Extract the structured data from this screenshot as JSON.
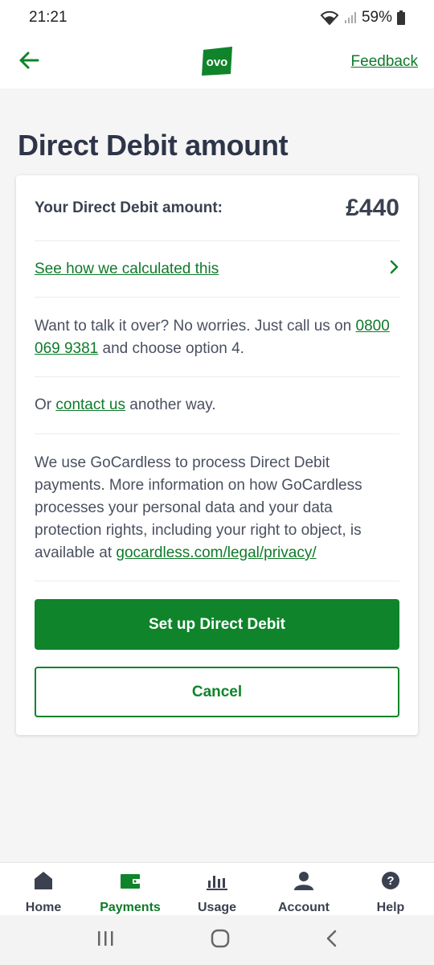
{
  "status_bar": {
    "time": "21:21",
    "battery": "59%"
  },
  "header": {
    "feedback_label": "Feedback",
    "logo_text": "ovo"
  },
  "page": {
    "title": "Direct Debit amount"
  },
  "card": {
    "amount_label": "Your Direct Debit amount:",
    "amount_value": "£440",
    "calc_link": "See how we calculated this",
    "talk_prefix": "Want to talk it over? No worries. Just call us on ",
    "phone": "0800 069 9381",
    "talk_suffix": " and choose option 4.",
    "contact_prefix": "Or ",
    "contact_link": "contact us",
    "contact_suffix": " another way.",
    "gc_text": "We use GoCardless to process Direct Debit payments. More information on how GoCardless processes your personal data and your data protection rights, including your right to object, is available at ",
    "gc_link": "gocardless.com/legal/privacy/"
  },
  "buttons": {
    "primary": "Set up Direct Debit",
    "secondary": "Cancel"
  },
  "bottom_nav": {
    "items": [
      {
        "label": "Home",
        "icon": "home-icon"
      },
      {
        "label": "Payments",
        "icon": "wallet-icon",
        "active": true
      },
      {
        "label": "Usage",
        "icon": "bar-chart-icon"
      },
      {
        "label": "Account",
        "icon": "person-icon"
      },
      {
        "label": "Help",
        "icon": "help-icon"
      }
    ]
  },
  "colors": {
    "brand_green": "#0f842b",
    "text_dark": "#2e3549"
  }
}
